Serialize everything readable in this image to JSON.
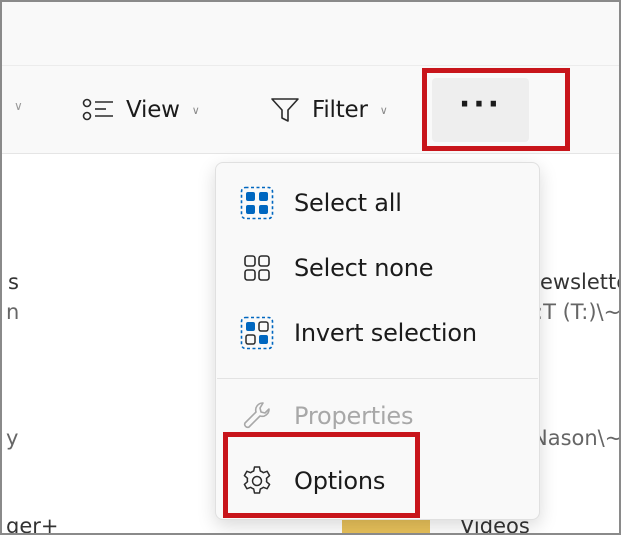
{
  "toolbar": {
    "view_label": "View",
    "filter_label": "Filter",
    "more_label": "···"
  },
  "background_peek": {
    "left_fragments": [
      "s",
      "n",
      "y",
      "ger+"
    ],
    "right_fragments": [
      "ewslette",
      ":T (T:)\\~",
      "Nason\\~",
      "Videos"
    ]
  },
  "menu": {
    "items": [
      {
        "label": "Select all",
        "icon": "select-all-icon",
        "disabled": false
      },
      {
        "label": "Select none",
        "icon": "select-none-icon",
        "disabled": false
      },
      {
        "label": "Invert selection",
        "icon": "invert-selection-icon",
        "disabled": false
      },
      {
        "label": "Properties",
        "icon": "wrench-icon",
        "disabled": true
      },
      {
        "label": "Options",
        "icon": "gear-icon",
        "disabled": false
      }
    ]
  },
  "colors": {
    "highlight": "#c8151b",
    "accent": "#0067c0",
    "menu_bg": "#f9f9f9",
    "disabled_text": "#a8a8a8"
  }
}
